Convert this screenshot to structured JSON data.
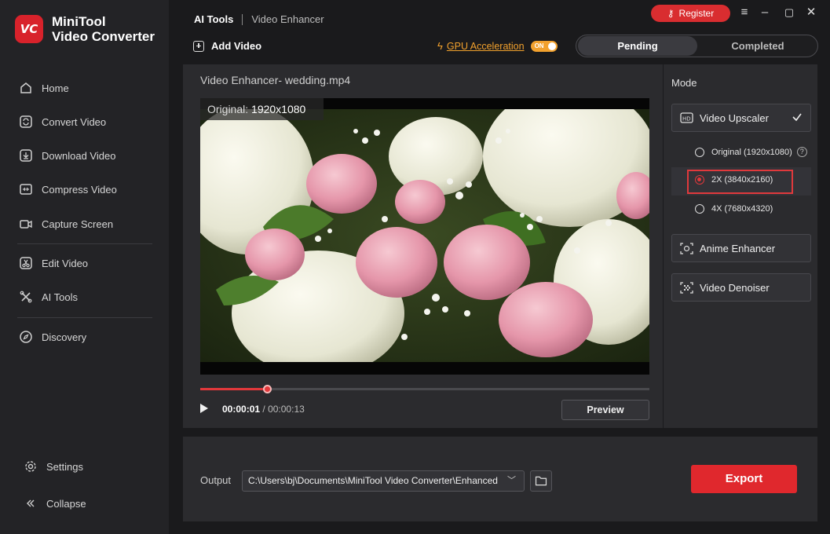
{
  "app": {
    "brand_line1": "MiniTool",
    "brand_line2": "Video Converter",
    "logo_text": "VC",
    "accent": "#d8222b"
  },
  "sidebar": {
    "items": [
      {
        "label": "Home",
        "icon": "home-icon"
      },
      {
        "label": "Convert Video",
        "icon": "convert-icon"
      },
      {
        "label": "Download Video",
        "icon": "download-icon"
      },
      {
        "label": "Compress Video",
        "icon": "compress-icon"
      },
      {
        "label": "Capture Screen",
        "icon": "camera-icon"
      },
      {
        "label": "Edit Video",
        "icon": "scissors-icon"
      },
      {
        "label": "AI Tools",
        "icon": "ai-tools-icon"
      },
      {
        "label": "Discovery",
        "icon": "compass-icon"
      }
    ],
    "settings": "Settings",
    "collapse": "Collapse"
  },
  "header": {
    "breadcrumb_root": "AI Tools",
    "breadcrumb_current": "Video Enhancer",
    "add_video": "Add Video",
    "gpu_label": "GPU Acceleration",
    "gpu_toggle": "ON",
    "register": "Register",
    "tabs": [
      "Pending",
      "Completed"
    ]
  },
  "player": {
    "title": "Video Enhancer- wedding.mp4",
    "original_prefix": "Original:",
    "original_res": "1920x1080",
    "current_time": "00:00:01",
    "separator": "/",
    "total_time": "00:00:13",
    "progress": 0.148,
    "preview": "Preview"
  },
  "mode": {
    "title": "Mode",
    "upscaler": "Video Upscaler",
    "options": [
      "Original (1920x1080)",
      "2X (3840x2160)",
      "4X (7680x4320)"
    ],
    "selected_option": "2X (3840x2160)",
    "anime": "Anime Enhancer",
    "denoiser": "Video Denoiser"
  },
  "output": {
    "label": "Output",
    "path": "C:\\Users\\bj\\Documents\\MiniTool Video Converter\\Enhanced",
    "export": "Export"
  }
}
